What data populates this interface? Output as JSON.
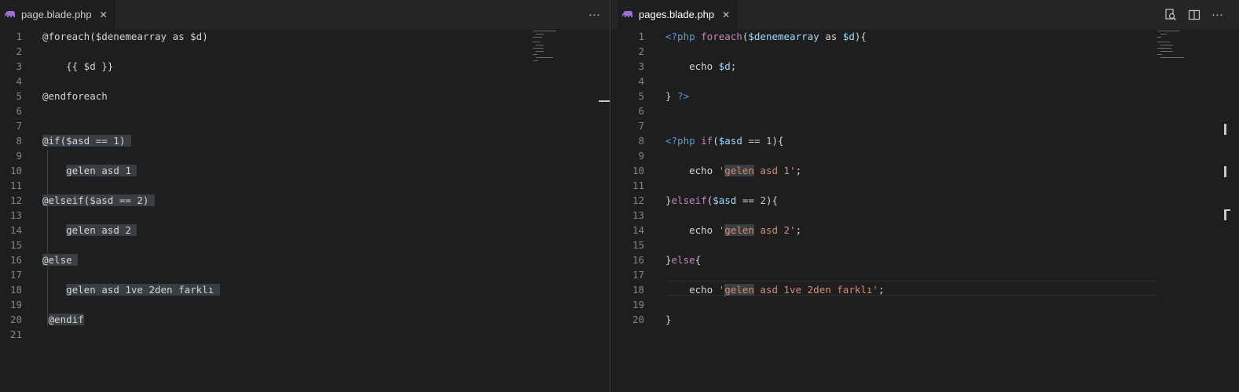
{
  "left": {
    "tab": {
      "title": "page.blade.php",
      "close": "✕"
    },
    "more": "···",
    "lines": [
      {
        "n": "1",
        "segs": [
          {
            "t": "@foreach($denemearray as $d)",
            "c": "t-blade"
          }
        ]
      },
      {
        "n": "2",
        "segs": []
      },
      {
        "n": "3",
        "segs": [
          {
            "t": "    {{ $d }}",
            "c": "t-plain"
          }
        ]
      },
      {
        "n": "4",
        "segs": []
      },
      {
        "n": "5",
        "segs": [
          {
            "t": "@endforeach",
            "c": "t-blade"
          }
        ]
      },
      {
        "n": "6",
        "segs": []
      },
      {
        "n": "7",
        "segs": []
      },
      {
        "n": "8",
        "segs": [
          {
            "t": "@if($asd == 1) ",
            "c": "t-blade hl"
          }
        ]
      },
      {
        "n": "9",
        "segs": []
      },
      {
        "n": "10",
        "segs": [
          {
            "t": "    ",
            "c": "t-plain"
          },
          {
            "t": "gelen asd 1 ",
            "c": "t-plain hl"
          }
        ]
      },
      {
        "n": "11",
        "segs": []
      },
      {
        "n": "12",
        "segs": [
          {
            "t": "@elseif($asd == 2) ",
            "c": "t-blade hl"
          }
        ]
      },
      {
        "n": "13",
        "segs": []
      },
      {
        "n": "14",
        "segs": [
          {
            "t": "    ",
            "c": "t-plain"
          },
          {
            "t": "gelen asd 2 ",
            "c": "t-plain hl"
          }
        ]
      },
      {
        "n": "15",
        "segs": []
      },
      {
        "n": "16",
        "segs": [
          {
            "t": "@else ",
            "c": "t-blade hl"
          }
        ]
      },
      {
        "n": "17",
        "segs": []
      },
      {
        "n": "18",
        "segs": [
          {
            "t": "    ",
            "c": "t-plain"
          },
          {
            "t": "gelen asd 1ve 2den farklı ",
            "c": "t-plain hl"
          }
        ]
      },
      {
        "n": "19",
        "segs": []
      },
      {
        "n": "20",
        "segs": [
          {
            "t": " ",
            "c": "t-plain"
          },
          {
            "t": "@endif",
            "c": "t-blade hl"
          }
        ]
      },
      {
        "n": "21",
        "segs": []
      }
    ]
  },
  "right": {
    "tab": {
      "title": "pages.blade.php",
      "close": "✕"
    },
    "more": "···",
    "lines": [
      {
        "n": "1",
        "segs": [
          {
            "t": "<?php ",
            "c": "t-tag"
          },
          {
            "t": "foreach",
            "c": "t-kw"
          },
          {
            "t": "(",
            "c": "t-p"
          },
          {
            "t": "$denemearray",
            "c": "t-var"
          },
          {
            "t": " as ",
            "c": "t-p"
          },
          {
            "t": "$d",
            "c": "t-var"
          },
          {
            "t": "){",
            "c": "t-p"
          }
        ]
      },
      {
        "n": "2",
        "segs": []
      },
      {
        "n": "3",
        "segs": [
          {
            "t": "    echo ",
            "c": "t-p"
          },
          {
            "t": "$d",
            "c": "t-var"
          },
          {
            "t": ";",
            "c": "t-p"
          }
        ]
      },
      {
        "n": "4",
        "segs": []
      },
      {
        "n": "5",
        "segs": [
          {
            "t": "} ",
            "c": "t-p"
          },
          {
            "t": "?>",
            "c": "t-tag"
          }
        ]
      },
      {
        "n": "6",
        "segs": []
      },
      {
        "n": "7",
        "segs": []
      },
      {
        "n": "8",
        "segs": [
          {
            "t": "<?php ",
            "c": "t-tag"
          },
          {
            "t": "if",
            "c": "t-kw"
          },
          {
            "t": "(",
            "c": "t-p"
          },
          {
            "t": "$asd",
            "c": "t-var"
          },
          {
            "t": " == ",
            "c": "t-p"
          },
          {
            "t": "1",
            "c": "t-num"
          },
          {
            "t": "){",
            "c": "t-p"
          }
        ]
      },
      {
        "n": "9",
        "segs": []
      },
      {
        "n": "10",
        "segs": [
          {
            "t": "    echo ",
            "c": "t-p"
          },
          {
            "t": "'",
            "c": "t-str"
          },
          {
            "t": "gelen",
            "c": "t-str word-hl"
          },
          {
            "t": " asd 1'",
            "c": "t-str"
          },
          {
            "t": ";",
            "c": "t-p"
          }
        ]
      },
      {
        "n": "11",
        "segs": []
      },
      {
        "n": "12",
        "segs": [
          {
            "t": "}",
            "c": "t-p"
          },
          {
            "t": "elseif",
            "c": "t-kw"
          },
          {
            "t": "(",
            "c": "t-p"
          },
          {
            "t": "$asd",
            "c": "t-var"
          },
          {
            "t": " == ",
            "c": "t-p"
          },
          {
            "t": "2",
            "c": "t-num"
          },
          {
            "t": "){",
            "c": "t-p"
          }
        ]
      },
      {
        "n": "13",
        "segs": []
      },
      {
        "n": "14",
        "segs": [
          {
            "t": "    echo ",
            "c": "t-p"
          },
          {
            "t": "'",
            "c": "t-str"
          },
          {
            "t": "gelen",
            "c": "t-str word-hl"
          },
          {
            "t": " asd 2'",
            "c": "t-str"
          },
          {
            "t": ";",
            "c": "t-p"
          }
        ]
      },
      {
        "n": "15",
        "segs": []
      },
      {
        "n": "16",
        "segs": [
          {
            "t": "}",
            "c": "t-p"
          },
          {
            "t": "else",
            "c": "t-kw"
          },
          {
            "t": "{",
            "c": "t-p"
          }
        ]
      },
      {
        "n": "17",
        "segs": []
      },
      {
        "n": "18",
        "segs": [
          {
            "t": "    echo ",
            "c": "t-p"
          },
          {
            "t": "'",
            "c": "t-str"
          },
          {
            "t": "CURSOR",
            "c": "cursor"
          },
          {
            "t": "gelen",
            "c": "t-str word-hl"
          },
          {
            "t": " asd 1ve 2den farklı'",
            "c": "t-str"
          },
          {
            "t": ";",
            "c": "t-p"
          }
        ]
      },
      {
        "n": "19",
        "segs": []
      },
      {
        "n": "20",
        "segs": [
          {
            "t": "}",
            "c": "t-p"
          }
        ]
      }
    ]
  },
  "icons": {
    "file": "php-elephant-icon",
    "find": "open-changes-icon",
    "split": "split-editor-icon"
  },
  "colors": {
    "editor_bg": "#1e1e1e",
    "tabbar_bg": "#252526",
    "line_number": "#858585",
    "keyword": "#c586c0",
    "php_tag": "#569cd6",
    "variable": "#9cdcfe",
    "string": "#ce9178",
    "number": "#b5cea8",
    "highlight": "#3a3d41",
    "elephant": "#9b6fd6"
  }
}
